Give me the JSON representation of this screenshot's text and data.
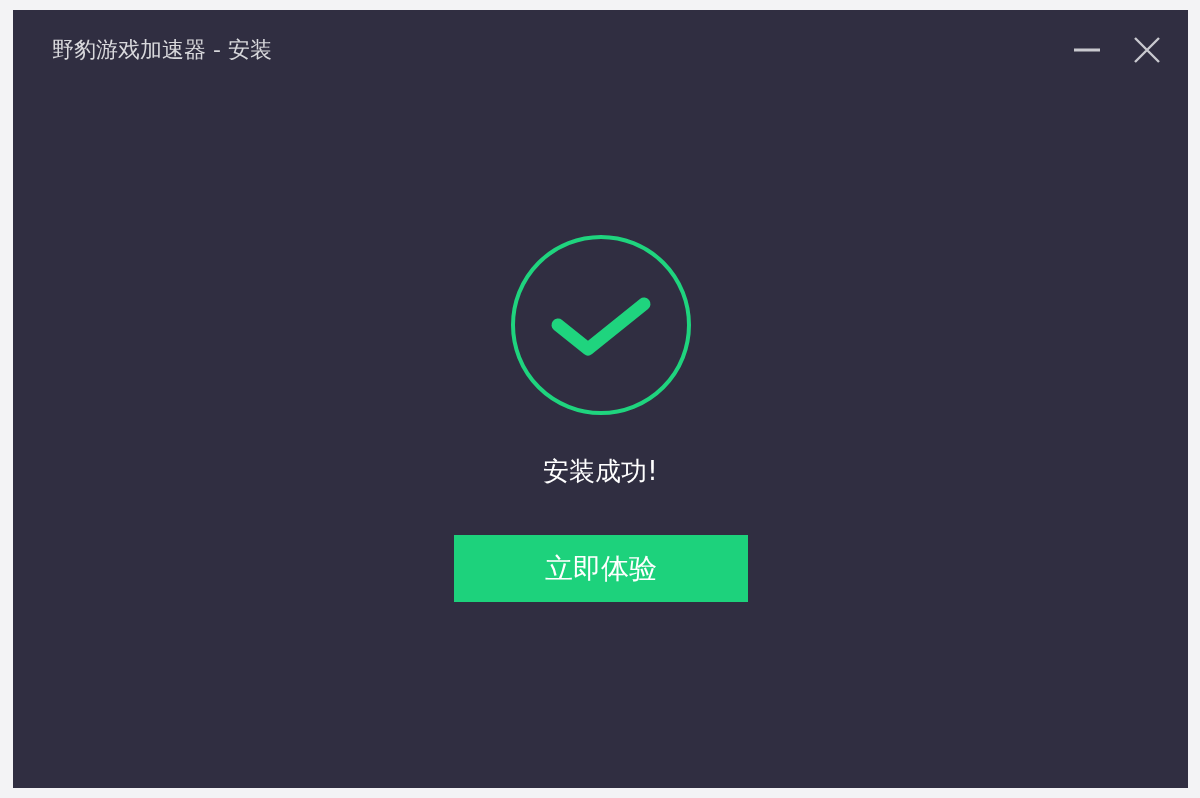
{
  "window": {
    "title": "野豹游戏加速器 - 安装"
  },
  "status": {
    "message": "安装成功!"
  },
  "buttons": [
    {
      "label": "立即体验"
    }
  ]
}
